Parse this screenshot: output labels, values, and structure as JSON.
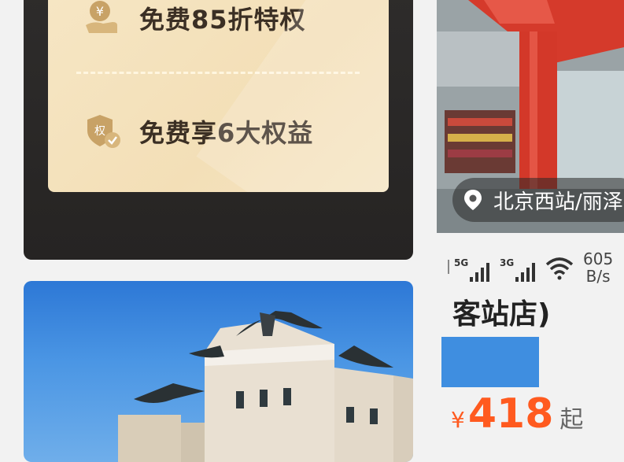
{
  "benefits": {
    "discount_label": "免费85折特权",
    "rights_label": "免费享6大权益",
    "rights_icon_char": "权",
    "yen_icon_char": "¥"
  },
  "hotel": {
    "location": "北京西站/丽泽",
    "name_fragment": "客站店)",
    "price_currency": "¥",
    "price_value": "418",
    "price_suffix": "起"
  },
  "statusbar": {
    "net1": "5G",
    "net2": "3G",
    "speed_value": "605",
    "speed_unit": "B/s"
  },
  "colors": {
    "gold_panel": "#f4e2bd",
    "dark_card": "#2b2928",
    "price_orange": "#ff5a1f",
    "sky_blue": "#3f8ee0"
  }
}
